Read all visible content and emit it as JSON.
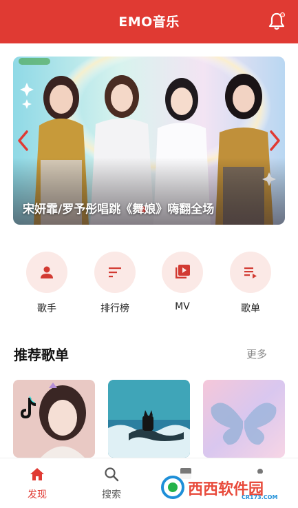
{
  "header": {
    "title": "EMO音乐",
    "accent": "#e03a33"
  },
  "banner": {
    "caption": "宋妍霏/罗予彤唱跳《舞娘》嗨翻全场"
  },
  "quick_nav": [
    {
      "label": "歌手",
      "icon": "person-icon"
    },
    {
      "label": "排行榜",
      "icon": "sort-lines-icon"
    },
    {
      "label": "MV",
      "icon": "video-library-icon"
    },
    {
      "label": "歌单",
      "icon": "playlist-play-icon"
    }
  ],
  "recommend": {
    "title": "推荐歌单",
    "more": "更多"
  },
  "bottom_nav": [
    {
      "label": "发现",
      "icon": "home-icon",
      "active": true
    },
    {
      "label": "搜索",
      "icon": "search-icon",
      "active": false
    }
  ],
  "watermark": {
    "text": "西西软件园",
    "sub": "CR173.COM"
  }
}
